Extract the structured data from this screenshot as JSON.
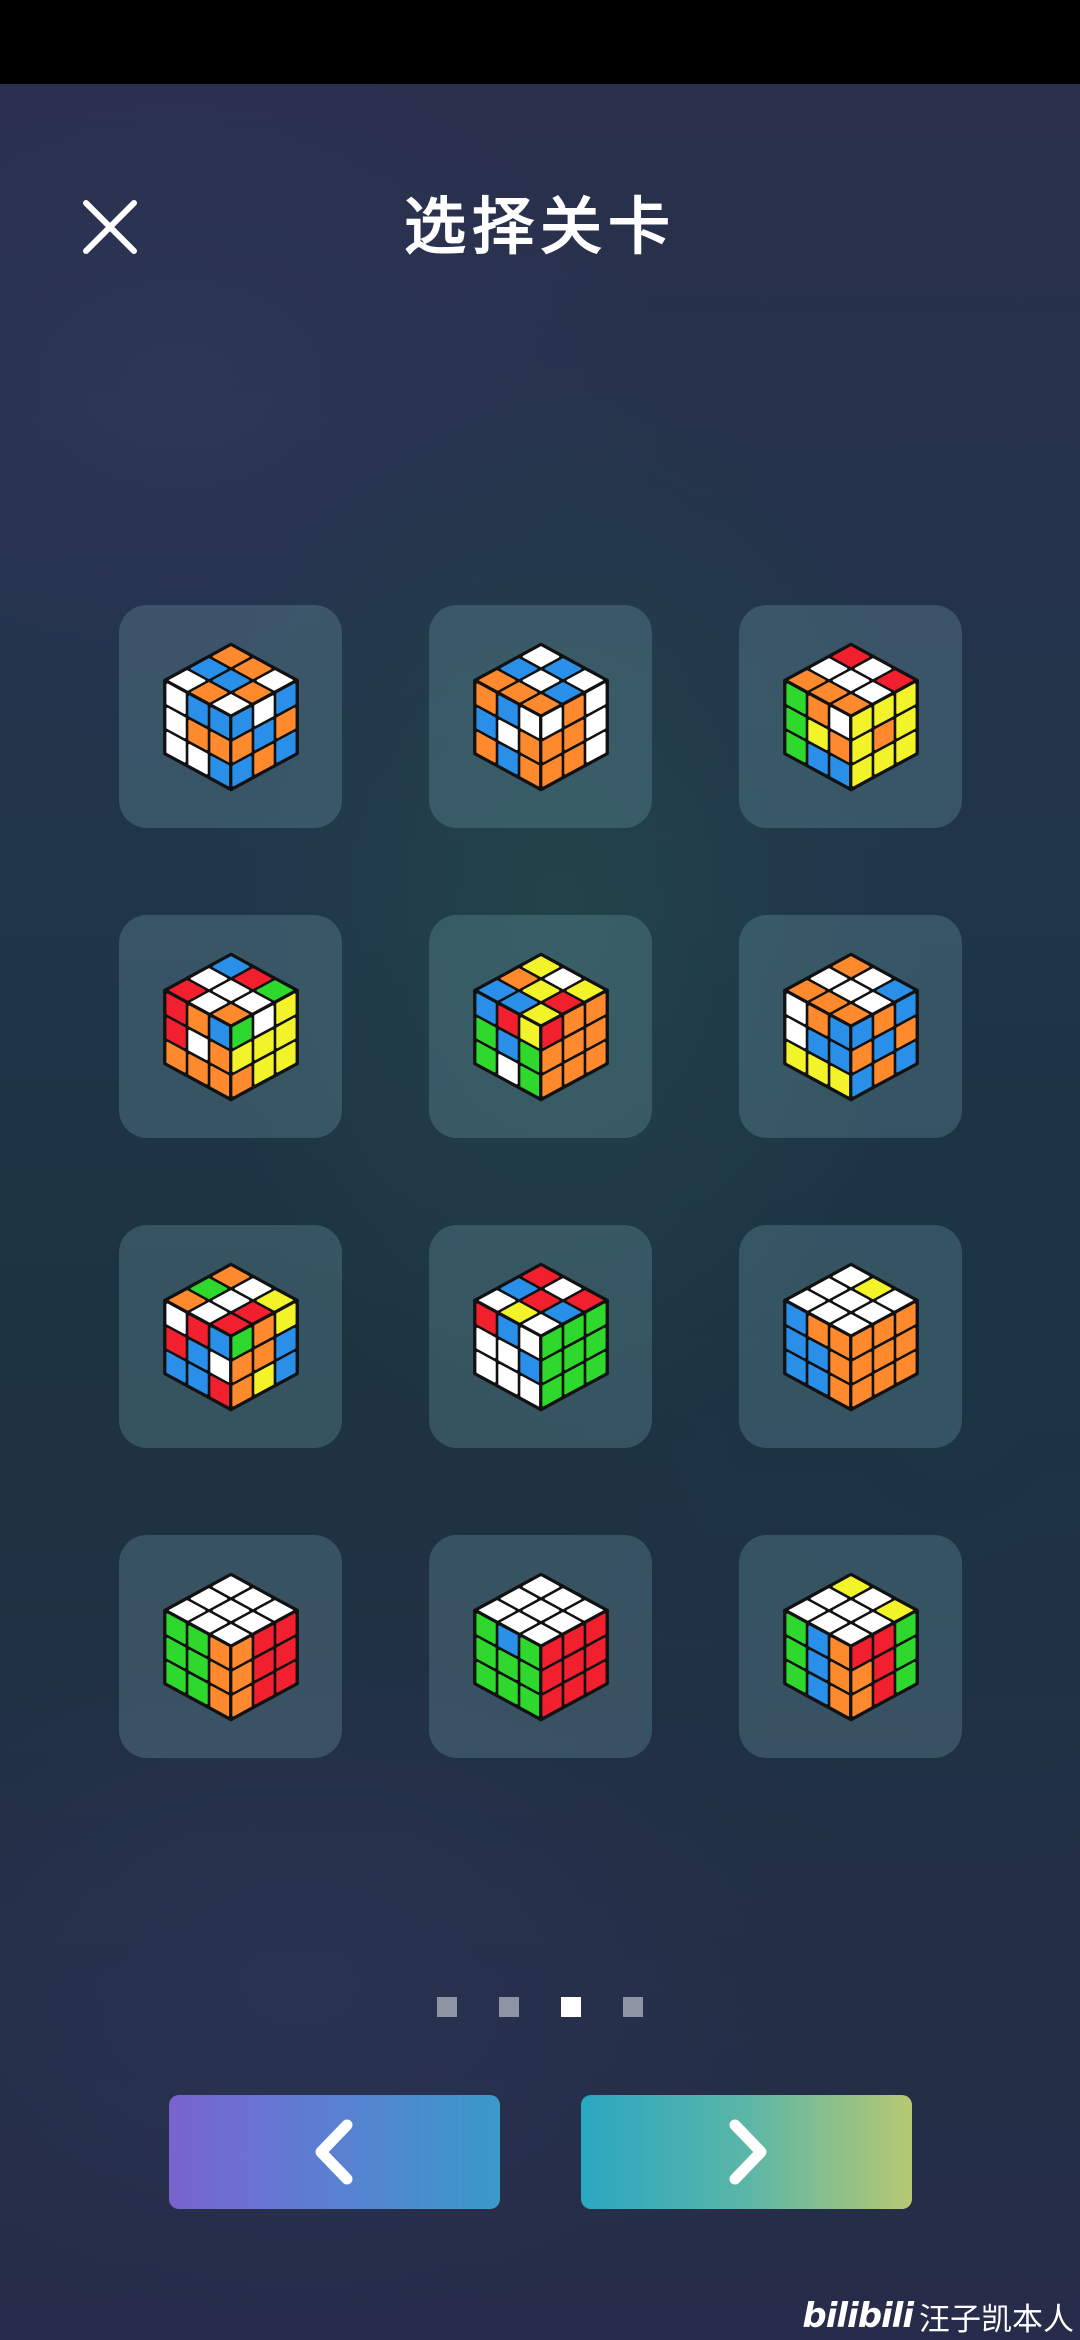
{
  "header": {
    "title": "选择关卡",
    "close_icon": "close-icon"
  },
  "levels": [
    {
      "top": [
        "O",
        "O",
        "W",
        "B",
        "B",
        "O",
        "W",
        "O",
        "W"
      ],
      "left": [
        "W",
        "B",
        "B",
        "W",
        "O",
        "O",
        "W",
        "W",
        "B"
      ],
      "right": [
        "B",
        "W",
        "B",
        "O",
        "B",
        "O",
        "B",
        "O",
        "B"
      ]
    },
    {
      "top": [
        "W",
        "B",
        "W",
        "B",
        "W",
        "B",
        "O",
        "O",
        "O"
      ],
      "left": [
        "O",
        "B",
        "W",
        "B",
        "W",
        "O",
        "O",
        "B",
        "O"
      ],
      "right": [
        "W",
        "O",
        "W",
        "O",
        "O",
        "W",
        "O",
        "O",
        "W"
      ]
    },
    {
      "top": [
        "R",
        "W",
        "R",
        "W",
        "W",
        "W",
        "O",
        "O",
        "O"
      ],
      "left": [
        "G",
        "O",
        "W",
        "G",
        "Y",
        "O",
        "G",
        "B",
        "B"
      ],
      "right": [
        "Y",
        "Y",
        "Y",
        "Y",
        "O",
        "Y",
        "Y",
        "Y",
        "Y"
      ]
    },
    {
      "top": [
        "B",
        "R",
        "G",
        "W",
        "W",
        "W",
        "R",
        "W",
        "O"
      ],
      "left": [
        "R",
        "O",
        "B",
        "R",
        "W",
        "O",
        "O",
        "O",
        "O"
      ],
      "right": [
        "G",
        "W",
        "Y",
        "Y",
        "Y",
        "Y",
        "O",
        "Y",
        "Y"
      ]
    },
    {
      "top": [
        "Y",
        "W",
        "Y",
        "O",
        "Y",
        "R",
        "B",
        "B",
        "Y"
      ],
      "left": [
        "B",
        "R",
        "Y",
        "G",
        "B",
        "G",
        "G",
        "W",
        "G"
      ],
      "right": [
        "R",
        "O",
        "O",
        "O",
        "O",
        "O",
        "O",
        "O",
        "O"
      ]
    },
    {
      "top": [
        "O",
        "W",
        "B",
        "W",
        "W",
        "W",
        "O",
        "O",
        "O"
      ],
      "left": [
        "W",
        "O",
        "B",
        "W",
        "B",
        "B",
        "Y",
        "Y",
        "Y"
      ],
      "right": [
        "B",
        "O",
        "B",
        "O",
        "B",
        "O",
        "B",
        "O",
        "B"
      ]
    },
    {
      "top": [
        "O",
        "W",
        "Y",
        "G",
        "W",
        "R",
        "O",
        "W",
        "R"
      ],
      "left": [
        "W",
        "R",
        "B",
        "R",
        "B",
        "W",
        "B",
        "B",
        "R"
      ],
      "right": [
        "G",
        "O",
        "Y",
        "O",
        "O",
        "B",
        "O",
        "Y",
        "B"
      ]
    },
    {
      "top": [
        "R",
        "W",
        "R",
        "B",
        "R",
        "B",
        "W",
        "Y",
        "W"
      ],
      "left": [
        "R",
        "B",
        "W",
        "W",
        "W",
        "B",
        "W",
        "W",
        "W"
      ],
      "right": [
        "G",
        "G",
        "G",
        "G",
        "G",
        "G",
        "G",
        "G",
        "G"
      ]
    },
    {
      "top": [
        "W",
        "Y",
        "W",
        "W",
        "W",
        "W",
        "W",
        "W",
        "W"
      ],
      "left": [
        "B",
        "O",
        "O",
        "B",
        "B",
        "O",
        "B",
        "B",
        "O"
      ],
      "right": [
        "O",
        "O",
        "O",
        "O",
        "O",
        "O",
        "O",
        "O",
        "O"
      ]
    },
    {
      "top": [
        "W",
        "W",
        "W",
        "W",
        "W",
        "W",
        "W",
        "W",
        "W"
      ],
      "left": [
        "G",
        "G",
        "O",
        "G",
        "G",
        "O",
        "G",
        "G",
        "O"
      ],
      "right": [
        "O",
        "R",
        "R",
        "O",
        "R",
        "R",
        "O",
        "R",
        "R"
      ]
    },
    {
      "top": [
        "W",
        "W",
        "W",
        "W",
        "W",
        "W",
        "W",
        "W",
        "W"
      ],
      "left": [
        "G",
        "B",
        "G",
        "G",
        "G",
        "G",
        "G",
        "G",
        "G"
      ],
      "right": [
        "R",
        "R",
        "R",
        "R",
        "R",
        "R",
        "R",
        "R",
        "R"
      ]
    },
    {
      "top": [
        "Y",
        "W",
        "Y",
        "W",
        "W",
        "W",
        "W",
        "W",
        "W"
      ],
      "left": [
        "G",
        "B",
        "O",
        "G",
        "B",
        "O",
        "G",
        "B",
        "O"
      ],
      "right": [
        "R",
        "R",
        "G",
        "O",
        "R",
        "G",
        "O",
        "R",
        "G"
      ]
    }
  ],
  "sticker_colors": {
    "W": "#ffffff",
    "Y": "#f3f32a",
    "O": "#ff8a2e",
    "B": "#2a8fe8",
    "G": "#2fd82c",
    "R": "#f2202e"
  },
  "pagination": {
    "total": 4,
    "active_index": 2
  },
  "nav": {
    "prev_icon": "chevron-left-icon",
    "next_icon": "chevron-right-icon"
  },
  "watermark": {
    "logo": "bilibili",
    "text": "汪子凯本人"
  }
}
